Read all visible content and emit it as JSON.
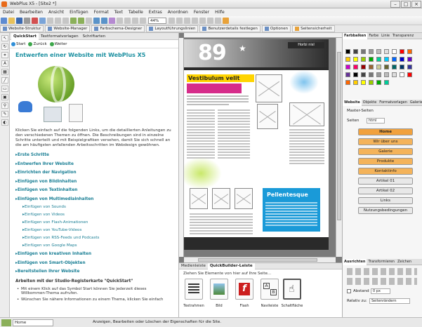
{
  "window": {
    "title": "WebPlus X5 - [Site2 *]"
  },
  "menu": [
    "Datei",
    "Bearbeiten",
    "Ansicht",
    "Einfügen",
    "Format",
    "Text",
    "Tabelle",
    "Extras",
    "Anordnen",
    "Fenster",
    "Hilfe"
  ],
  "toolbar": {
    "zoom": "44%"
  },
  "tabs": [
    "Website-Struktur",
    "Website-Manager",
    "Farbschema-Designer",
    "Layoutführungslinien",
    "Benutzerdetails festlegen",
    "Optionen",
    "Seitensicherheit"
  ],
  "quickstart": {
    "tabs": [
      "QuickStart",
      "Textformatvorlagen",
      "Schriftarten"
    ],
    "nav": [
      "Start",
      "Zurück",
      "Weiter"
    ],
    "title": "Entwerfen einer Website mit WebPlus X5",
    "intro": "Klicken Sie einfach auf die folgenden Links, um die detaillierten Anleitungen zu den verschiedenen Themen zu öffnen. Die Beschreibungen sind in einzelne Schritte unterteilt und mit Beispielgrafiken versehen, damit Sie sich schnell an die am häufigsten anfallenden Arbeitsschritten im Webdesign gewöhnen.",
    "links": [
      "Erste Schritte",
      "Entwerfen Ihrer Website",
      "Einrichten der Navigation",
      "Einfügen von Bildinhalten",
      "Einfügen von Textinhalten",
      "Einfügen von Multimediainhalten"
    ],
    "sublinks": [
      "Einfügen von Sounds",
      "Einfügen von Videos",
      "Einfügen von Flash-Animationen",
      "Einfügen von YouTube-Videos",
      "Einfügen von RSS-Feeds und Podcasts",
      "Einfügen von Google Maps"
    ],
    "links2": [
      "Einfügen von kreativen Inhalten",
      "Einfügen von Smart-Objekten",
      "Bereitstellen Ihrer Website"
    ],
    "section": "Arbeiten mit der Studio-Registerkarte \"QuickStart\"",
    "bullets": [
      "Mit einem Klick auf das Symbol  Start können Sie jederzeit dieses Willkommen-Thema aufrufen.",
      "Wünschen Sie nähere Informationen zu einem Thema, klicken Sie einfach"
    ]
  },
  "page": {
    "big_number": "89",
    "header_button": "Horbi nisl",
    "heading": "Vestibulum velit",
    "blue_title": "Pellentesque"
  },
  "bottom_panel": {
    "tabs": [
      "Medienleiste",
      "QuickBuilder-Leiste"
    ],
    "hint": "Ziehen Sie Elemente von hier auf Ihre Seite...",
    "items": [
      "Textrahmen",
      "Bild",
      "Flash",
      "Navileiste",
      "Schaltfläche"
    ]
  },
  "right": {
    "color_tabs": [
      "Farbbalken",
      "Farbe",
      "Linie",
      "Transparenz"
    ],
    "site_tabs": [
      "Website",
      "Objekte",
      "Formatvorlagen",
      "Galerie"
    ],
    "master_label": "Master-Seiten",
    "pages_label": "Seiten",
    "pages_html": "html",
    "pages": [
      "Home",
      "Wir über uns",
      "Galerie",
      "Produkte",
      "Kontaktinfo",
      "Artikel 01",
      "Artikel 02",
      "Links",
      "Nutzungsbedingungen"
    ],
    "align_tabs": [
      "Ausrichten",
      "Transformieren",
      "Zeichen"
    ],
    "abstand": "Abstand",
    "abstand_val": "0 px",
    "relativ": "Relativ zu:",
    "relativ_val": "Seitenrändern"
  },
  "status": {
    "page": "Home",
    "text": "Anzeigen, Bearbeiten oder Löschen der Eigenschaften für die Site."
  },
  "colors": {
    "accent": "#1a8fa0",
    "home_page": "#f1a13c",
    "page_orange": "#f4b35a"
  }
}
